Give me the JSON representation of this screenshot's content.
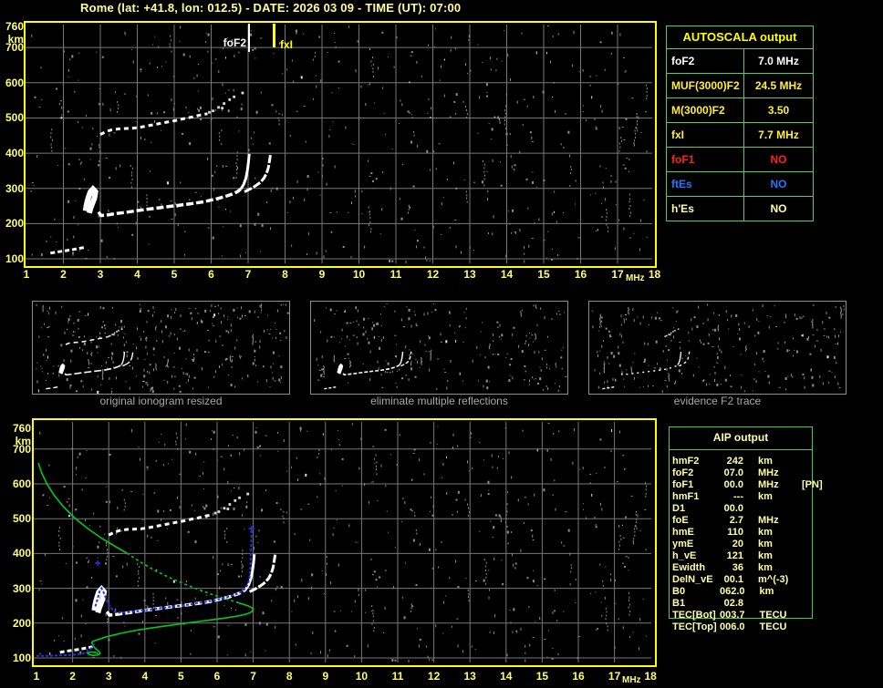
{
  "title": "Rome (lat: +41.8, lon: 012.5) - DATE: 2026 03 09 - TIME (UT): 07:00",
  "plots": {
    "x_ticks": [
      "1",
      "2",
      "3",
      "4",
      "5",
      "6",
      "7",
      "8",
      "9",
      "10",
      "11",
      "12",
      "13",
      "14",
      "15",
      "16",
      "17",
      "18"
    ],
    "x_unit": "MHz",
    "y_ticks": [
      "760",
      "700",
      "600",
      "500",
      "400",
      "300",
      "200",
      "100"
    ],
    "y_unit": "km",
    "markers": {
      "fof2": {
        "label": "foF2",
        "freq": 7.0
      },
      "fxi": {
        "label": "fxI",
        "freq": 7.7
      }
    }
  },
  "autoscala": {
    "header": "AUTOSCALA output",
    "rows": [
      {
        "label": "foF2",
        "value": "7.0 MHz",
        "color": "#ffffff"
      },
      {
        "label": "MUF(3000)F2",
        "value": "24.5 MHz",
        "color": "#ffee33"
      },
      {
        "label": "M(3000)F2",
        "value": "3.50",
        "color": "#ffee33"
      },
      {
        "label": "fxI",
        "value": "7.7 MHz",
        "color": "#ffee33"
      },
      {
        "label": "foF1",
        "value": "NO",
        "color": "#ff2222"
      },
      {
        "label": "ftEs",
        "value": "NO",
        "color": "#2277ff"
      },
      {
        "label": "h'Es",
        "value": "NO",
        "color": "#ffffa6"
      }
    ]
  },
  "thumbnails": [
    {
      "caption": "original ionogram resized"
    },
    {
      "caption": "eliminate multiple reflections"
    },
    {
      "caption": "evidence F2 trace"
    }
  ],
  "aip": {
    "header": "AIP output",
    "rows": [
      {
        "label": "hmF2",
        "value": "242",
        "unit": "km",
        "extra": ""
      },
      {
        "label": "foF2",
        "value": "07.0",
        "unit": "MHz",
        "extra": ""
      },
      {
        "label": "foF1",
        "value": "00.0",
        "unit": "MHz",
        "extra": "[PN]"
      },
      {
        "label": "hmF1",
        "value": "---",
        "unit": "km",
        "extra": ""
      },
      {
        "label": "D1",
        "value": "00.0",
        "unit": "",
        "extra": ""
      },
      {
        "label": "foE",
        "value": "2.7",
        "unit": "MHz",
        "extra": ""
      },
      {
        "label": "hmE",
        "value": "110",
        "unit": "km",
        "extra": ""
      },
      {
        "label": "ymE",
        "value": "20",
        "unit": "km",
        "extra": ""
      },
      {
        "label": "h_vE",
        "value": "121",
        "unit": "km",
        "extra": ""
      },
      {
        "label": "Ewidth",
        "value": "36",
        "unit": "km",
        "extra": ""
      },
      {
        "label": "DelN_vE",
        "value": "00.1",
        "unit": "m^(-3)",
        "extra": ""
      },
      {
        "label": "B0",
        "value": "062.0",
        "unit": "km",
        "extra": ""
      },
      {
        "label": "B1",
        "value": "02.8",
        "unit": "",
        "extra": ""
      },
      {
        "label": "TEC[Bot]",
        "value": "003.7",
        "unit": "TECU",
        "extra": ""
      },
      {
        "label": "TEC[Top]",
        "value": "006.0",
        "unit": "TECU",
        "extra": ""
      }
    ]
  },
  "chart_data": {
    "type": "scatter",
    "title": "ionogram echoes, height (km) vs frequency (MHz)",
    "xlabel": "MHz",
    "ylabel": "km",
    "xlim": [
      1,
      18
    ],
    "ylim": [
      100,
      760
    ],
    "traces": {
      "es_layer": [
        [
          1.65,
          116
        ],
        [
          1.8,
          119
        ],
        [
          2.0,
          122
        ],
        [
          2.2,
          125
        ],
        [
          2.4,
          129
        ],
        [
          2.55,
          132
        ]
      ],
      "f_blob": [
        [
          2.6,
          236
        ],
        [
          2.62,
          250
        ],
        [
          2.65,
          264
        ],
        [
          2.69,
          278
        ],
        [
          2.73,
          290
        ],
        [
          2.8,
          298
        ],
        [
          2.87,
          290
        ],
        [
          2.84,
          272
        ],
        [
          2.78,
          256
        ],
        [
          2.73,
          242
        ],
        [
          2.7,
          230
        ]
      ],
      "f_trace": [
        [
          2.95,
          233
        ],
        [
          3.02,
          223
        ],
        [
          3.15,
          224
        ],
        [
          3.4,
          228
        ],
        [
          3.7,
          232
        ],
        [
          4.0,
          237
        ],
        [
          4.3,
          241
        ],
        [
          4.6,
          245
        ],
        [
          4.9,
          249
        ],
        [
          5.2,
          253
        ],
        [
          5.5,
          257
        ],
        [
          5.8,
          262
        ],
        [
          6.1,
          269
        ],
        [
          6.35,
          276
        ],
        [
          6.55,
          283
        ],
        [
          6.7,
          290
        ],
        [
          6.8,
          298
        ]
      ],
      "f_o_asymptote": [
        [
          6.8,
          298
        ],
        [
          6.88,
          311
        ],
        [
          6.94,
          329
        ],
        [
          6.98,
          351
        ],
        [
          7.01,
          375
        ],
        [
          7.03,
          398
        ]
      ],
      "f_x_branch": [
        [
          6.9,
          290
        ],
        [
          7.05,
          298
        ],
        [
          7.2,
          307
        ],
        [
          7.33,
          317
        ],
        [
          7.43,
          329
        ],
        [
          7.5,
          343
        ],
        [
          7.55,
          360
        ],
        [
          7.58,
          379
        ],
        [
          7.61,
          400
        ]
      ],
      "second_hop": [
        [
          3.0,
          453
        ],
        [
          3.15,
          461
        ],
        [
          3.3,
          466
        ],
        [
          3.5,
          469
        ],
        [
          3.7,
          470
        ],
        [
          3.9,
          471
        ],
        [
          4.1,
          474
        ],
        [
          4.3,
          478
        ],
        [
          4.5,
          482
        ],
        [
          4.7,
          486
        ],
        [
          4.9,
          490
        ],
        [
          5.1,
          494
        ],
        [
          5.3,
          499
        ],
        [
          5.5,
          503
        ],
        [
          5.7,
          508
        ],
        [
          5.9,
          512
        ]
      ],
      "second_hop_sparse": [
        [
          5.95,
          516
        ],
        [
          6.05,
          520
        ],
        [
          6.2,
          530
        ],
        [
          6.3,
          528
        ],
        [
          6.35,
          541
        ],
        [
          6.5,
          552
        ],
        [
          6.62,
          560
        ],
        [
          6.85,
          571
        ]
      ],
      "profile_solid": [
        [
          1.05,
          660
        ],
        [
          1.15,
          630
        ],
        [
          1.3,
          598
        ],
        [
          1.5,
          566
        ],
        [
          1.75,
          534
        ],
        [
          2.05,
          503
        ],
        [
          2.4,
          473
        ],
        [
          2.8,
          444
        ],
        [
          3.2,
          419
        ],
        [
          3.5,
          401
        ]
      ],
      "profile_dashed": [
        [
          3.5,
          401
        ],
        [
          3.9,
          374
        ],
        [
          4.3,
          350
        ],
        [
          4.7,
          330
        ],
        [
          5.1,
          312
        ],
        [
          5.5,
          296
        ],
        [
          5.9,
          281
        ],
        [
          6.3,
          268
        ],
        [
          6.6,
          258
        ]
      ],
      "profile_nose": [
        [
          6.6,
          258
        ],
        [
          6.85,
          250
        ],
        [
          7.0,
          242
        ],
        [
          6.97,
          233
        ],
        [
          6.84,
          227
        ],
        [
          6.6,
          221
        ],
        [
          6.25,
          215
        ],
        [
          5.8,
          209
        ],
        [
          5.3,
          202
        ],
        [
          4.8,
          195
        ],
        [
          4.3,
          188
        ],
        [
          3.8,
          180
        ],
        [
          3.35,
          171
        ],
        [
          2.95,
          161
        ],
        [
          2.68,
          152
        ],
        [
          2.53,
          146
        ]
      ],
      "profile_e": [
        [
          2.53,
          146
        ],
        [
          2.56,
          137
        ],
        [
          2.61,
          129
        ],
        [
          2.68,
          123
        ],
        [
          2.74,
          117
        ],
        [
          2.76,
          112
        ],
        [
          2.68,
          108
        ],
        [
          2.56,
          107
        ],
        [
          2.45,
          110
        ],
        [
          2.41,
          114
        ],
        [
          2.5,
          117
        ],
        [
          2.63,
          116
        ],
        [
          2.7,
          112
        ]
      ],
      "restored_low": [
        [
          1.0,
          106
        ],
        [
          1.3,
          106
        ],
        [
          1.6,
          107
        ],
        [
          1.9,
          108
        ],
        [
          2.1,
          110
        ],
        [
          2.3,
          113
        ],
        [
          2.45,
          120
        ],
        [
          2.55,
          132
        ],
        [
          2.6,
          142
        ]
      ],
      "restored_main": [
        [
          2.63,
          248
        ],
        [
          2.67,
          262
        ],
        [
          2.71,
          277
        ],
        [
          2.75,
          292
        ],
        [
          2.8,
          300
        ],
        [
          2.86,
          288
        ],
        [
          2.92,
          272
        ],
        [
          2.98,
          257
        ],
        [
          3.05,
          245
        ],
        [
          3.12,
          236
        ],
        [
          3.2,
          231
        ],
        [
          3.4,
          230
        ],
        [
          3.7,
          233
        ],
        [
          4.0,
          237
        ],
        [
          4.3,
          241
        ],
        [
          4.6,
          245
        ],
        [
          4.9,
          249
        ],
        [
          5.2,
          253
        ],
        [
          5.5,
          258
        ],
        [
          5.8,
          263
        ],
        [
          6.1,
          270
        ],
        [
          6.35,
          277
        ],
        [
          6.55,
          284
        ],
        [
          6.7,
          292
        ],
        [
          6.8,
          302
        ],
        [
          6.86,
          315
        ],
        [
          6.9,
          333
        ],
        [
          6.92,
          356
        ],
        [
          6.93,
          385
        ],
        [
          6.94,
          415
        ],
        [
          6.95,
          445
        ],
        [
          6.95,
          466
        ]
      ],
      "restored_marks": [
        [
          2.7,
          372
        ],
        [
          6.95,
          472
        ]
      ]
    },
    "series_colors": {
      "echo_trace": "#ffffff",
      "density_profile": "#00c822",
      "restored_trace": "#2233ee"
    }
  },
  "noise": {
    "seed": 20260309,
    "plot_dots": 560,
    "streaks": 24,
    "thumb_dots": [
      320,
      230,
      250
    ]
  }
}
